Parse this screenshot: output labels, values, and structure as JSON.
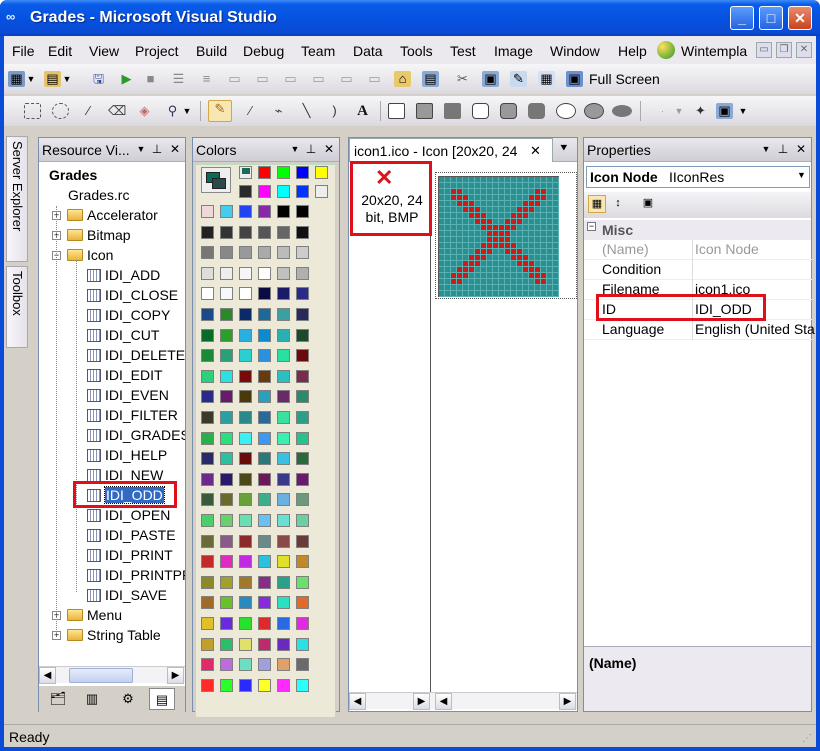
{
  "window": {
    "title": "Grades - Microsoft Visual Studio",
    "minimize": "_",
    "maximize": "□",
    "close": "✕"
  },
  "menu": {
    "items": [
      {
        "label": "File"
      },
      {
        "label": "Edit"
      },
      {
        "label": "View"
      },
      {
        "label": "Project"
      },
      {
        "label": "Build"
      },
      {
        "label": "Debug"
      },
      {
        "label": "Team"
      },
      {
        "label": "Data"
      },
      {
        "label": "Tools"
      },
      {
        "label": "Test"
      },
      {
        "label": "Image"
      },
      {
        "label": "Window"
      },
      {
        "label": "Help"
      }
    ],
    "addin_label": "Wintempla"
  },
  "toolbar": {
    "full_screen_label": "Full Screen",
    "text_tool": "A"
  },
  "side_tabs": {
    "server_explorer": "Server Explorer",
    "toolbox": "Toolbox"
  },
  "resource_view": {
    "title": "Resource Vi...",
    "tree": {
      "root": "Grades",
      "rc_file": "Grades.rc",
      "folders": [
        "Accelerator",
        "Bitmap",
        "Icon"
      ],
      "icons": [
        "IDI_ADD",
        "IDI_CLOSE",
        "IDI_COPY",
        "IDI_CUT",
        "IDI_DELETE",
        "IDI_EDIT",
        "IDI_EVEN",
        "IDI_FILTER",
        "IDI_GRADES",
        "IDI_HELP",
        "IDI_NEW",
        "IDI_ODD",
        "IDI_OPEN",
        "IDI_PASTE",
        "IDI_PRINT",
        "IDI_PRINTPR",
        "IDI_SAVE"
      ],
      "after_folders": [
        "Menu",
        "String Table"
      ],
      "selected": "IDI_ODD"
    }
  },
  "colors_panel": {
    "title": "Colors"
  },
  "editor": {
    "tab_title": "icon1.ico - Icon [20x20, 24",
    "image_type_label": "20x20, 24 bit, BMP",
    "canvas": {
      "cells": 20,
      "background_color": "#2a8f91",
      "mark_color": "#cf1a1a"
    }
  },
  "properties": {
    "title": "Properties",
    "object_name": "Icon Node",
    "object_type": "IIconRes",
    "category": "Misc",
    "rows": [
      {
        "name": "(Name)",
        "value": "Icon Node",
        "dimmed": true
      },
      {
        "name": "Condition",
        "value": ""
      },
      {
        "name": "Filename",
        "value": "icon1.ico"
      },
      {
        "name": "ID",
        "value": "IDI_ODD"
      },
      {
        "name": "Language",
        "value": "English (United Sta"
      }
    ],
    "description_title": "(Name)"
  },
  "status": {
    "text": "Ready"
  },
  "colors": {
    "accent_red": "#e0101a",
    "title_blue": "#0a5ce9",
    "selection_blue": "#316ac5"
  }
}
